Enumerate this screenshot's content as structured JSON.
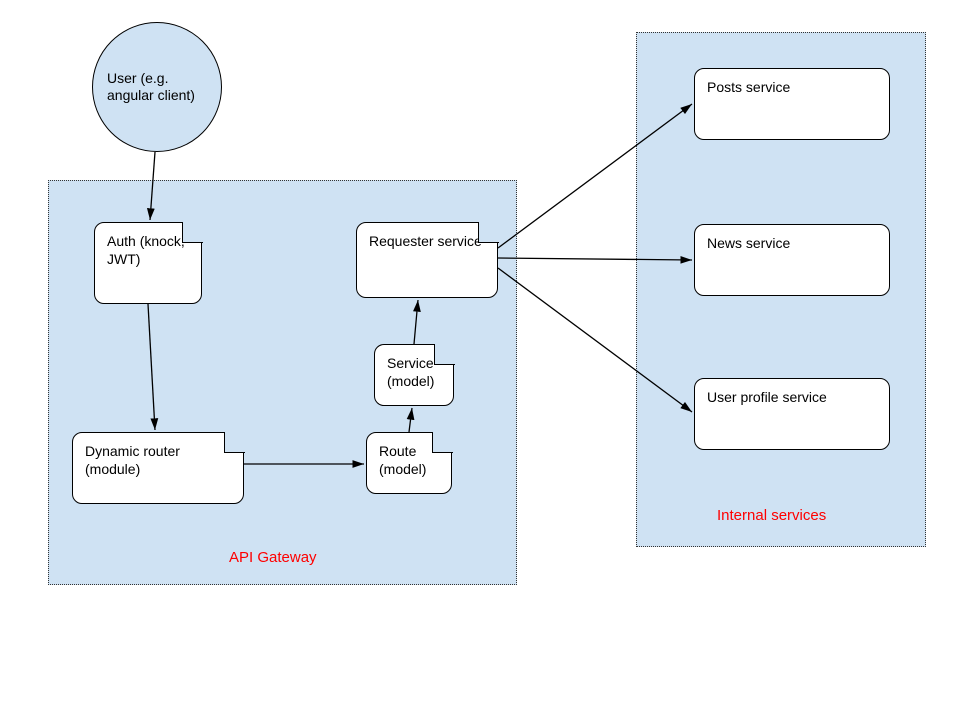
{
  "nodes": {
    "user": "User (e.g. angular client)",
    "auth": "Auth (knock, JWT)",
    "dynamic_router": "Dynamic router (module)",
    "route": "Route (model)",
    "service_model": "Service (model)",
    "requester": "Requester service",
    "posts": "Posts service",
    "news": "News service",
    "user_profile": "User profile service"
  },
  "regions": {
    "api_gateway": "API Gateway",
    "internal_services": "Internal services"
  }
}
